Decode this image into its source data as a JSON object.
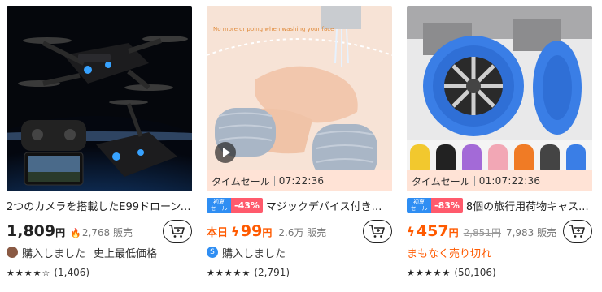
{
  "products": [
    {
      "title": "2つのカメラを搭載したE99ドローン、折り...",
      "price": "1,809",
      "yen": "円",
      "sold_count": "2,768 販売",
      "meta_text": "購入しました",
      "meta_extra": "史上最低価格",
      "stars": "★★★★☆",
      "rating_count": "(1,406)"
    },
    {
      "sale_label": "タイムセール",
      "sale_timer": "07:22:36",
      "badge_top": "初夏",
      "badge_bottom": "セール",
      "discount": "-43%",
      "title": "マジックデバイス付き洗顔...",
      "today_label": "本日",
      "price": "99",
      "yen": "円",
      "sold_count": "2.6万 販売",
      "avatar_letter": "S",
      "meta_text": "購入しました",
      "stars": "★★★★★",
      "rating_count": "(2,791)",
      "image_caption": "No more dripping when washing your face"
    },
    {
      "sale_label": "タイムセール",
      "sale_timer": "01:07:22:36",
      "badge_top": "初夏",
      "badge_bottom": "セール",
      "discount": "-83%",
      "title": "8個の旅行用荷物キャス...",
      "price": "457",
      "yen": "円",
      "original_price": "2,851円",
      "sold_count": "7,983 販売",
      "meta_text": "まもなく売り切れ",
      "stars": "★★★★★",
      "rating_count": "(50,106)"
    }
  ],
  "colors": {
    "accent": "#ff5a00",
    "badge_blue": "#2f8ef3",
    "badge_red": "#ff5a6c",
    "sale_bar": "#ffe3d6"
  },
  "icons": [
    "add-to-cart-icon",
    "play-icon",
    "flame-icon",
    "bolt-icon",
    "star-icon"
  ]
}
